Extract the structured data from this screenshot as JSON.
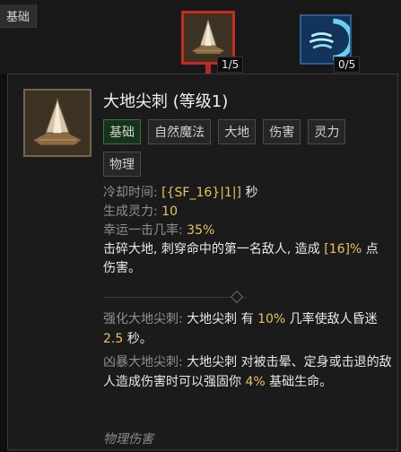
{
  "section_label": "基础",
  "nodes": [
    {
      "icon": "earth-spike-icon",
      "rank": "1/5",
      "selected": true
    },
    {
      "icon": "wind-shear-icon",
      "rank": "0/5",
      "selected": false
    }
  ],
  "tooltip": {
    "title": "大地尖刺 (等级1)",
    "tags": [
      "基础",
      "自然魔法",
      "大地",
      "伤害",
      "灵力",
      "物理"
    ],
    "stats": {
      "cooldown_label": "冷却时间: ",
      "cooldown_value": "[{SF_16}|1|]",
      "cooldown_unit": " 秒",
      "spirit_label": "生成灵力: ",
      "spirit_value": "10",
      "lucky_label": "幸运一击几率: ",
      "lucky_value": "35%"
    },
    "description_a": "击碎大地, 刺穿命中的第一名敌人, 造成 ",
    "description_value": "[16]%",
    "description_b": " 点伤害。",
    "upgrades": [
      {
        "label": "强化大地尖刺: ",
        "skill": "大地尖刺",
        "text_a": " 有 ",
        "value1": "10%",
        "text_b": " 几率使敌人昏迷 ",
        "value2": "2.5",
        "text_c": " 秒。"
      },
      {
        "label": "凶暴大地尖刺: ",
        "skill": "大地尖刺",
        "text_a": " 对被击晕、定身或击退的敌人造成伤害时可以强固你 ",
        "value1": "4%",
        "text_b": " 基础生命。"
      }
    ],
    "footer": "物理伤害"
  }
}
